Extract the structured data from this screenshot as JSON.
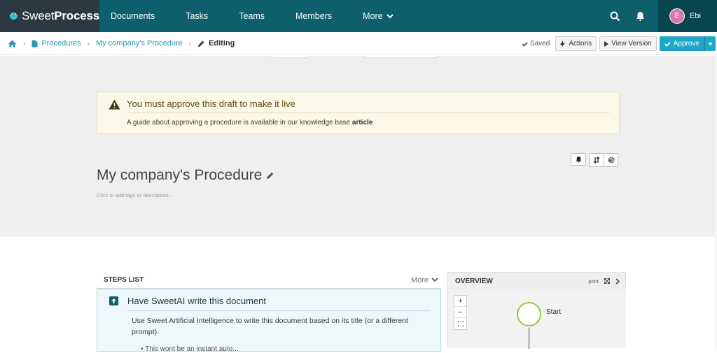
{
  "app": {
    "brand_light": "Sweet",
    "brand_bold": "Process",
    "nav": [
      "Documents",
      "Tasks",
      "Teams",
      "Members",
      "More"
    ],
    "user_initial": "E",
    "user_name": "Ebi"
  },
  "breadcrumb": {
    "items": [
      "Procedures",
      "My company's Procedure"
    ],
    "current": "Editing"
  },
  "toolbar": {
    "saved_label": "Saved",
    "actions_label": "Actions",
    "view_version_label": "View Version",
    "approve_label": "Approve"
  },
  "alert": {
    "title": "You must approve this draft to make it live",
    "body": "A guide about approving a procedure is available in our knowledge base ",
    "link": "article"
  },
  "document": {
    "title": "My company's Procedure",
    "description_placeholder": "Click to add tags or description..."
  },
  "steps": {
    "header": "STEPS LIST",
    "more_label": "More",
    "first_step_title": "Have SweetAI write this document",
    "first_step_body": "Use Sweet Artificial Intelligence to write this document based on its title (or a different prompt).",
    "first_step_cut": "• This wont be an instant auto..."
  },
  "overview": {
    "header": "OVERVIEW",
    "print_label": "print",
    "zoom_in": "+",
    "zoom_out": "−",
    "start_label": "Start"
  },
  "colors": {
    "nav_bg": "#0c5f6b",
    "brand_bg": "#2b3a42",
    "accent": "#1ea7c8",
    "link": "#2a97b6",
    "start_node": "#9acc37"
  },
  "icons": [
    "home-icon",
    "file-icon",
    "pencil-icon",
    "search-icon",
    "bell-icon",
    "warning-icon",
    "bolt-icon",
    "play-icon",
    "check-icon",
    "sort-icon",
    "globe-icon",
    "up-arrow-icon",
    "expand-icon",
    "chevron-right-icon",
    "fit-icon"
  ]
}
